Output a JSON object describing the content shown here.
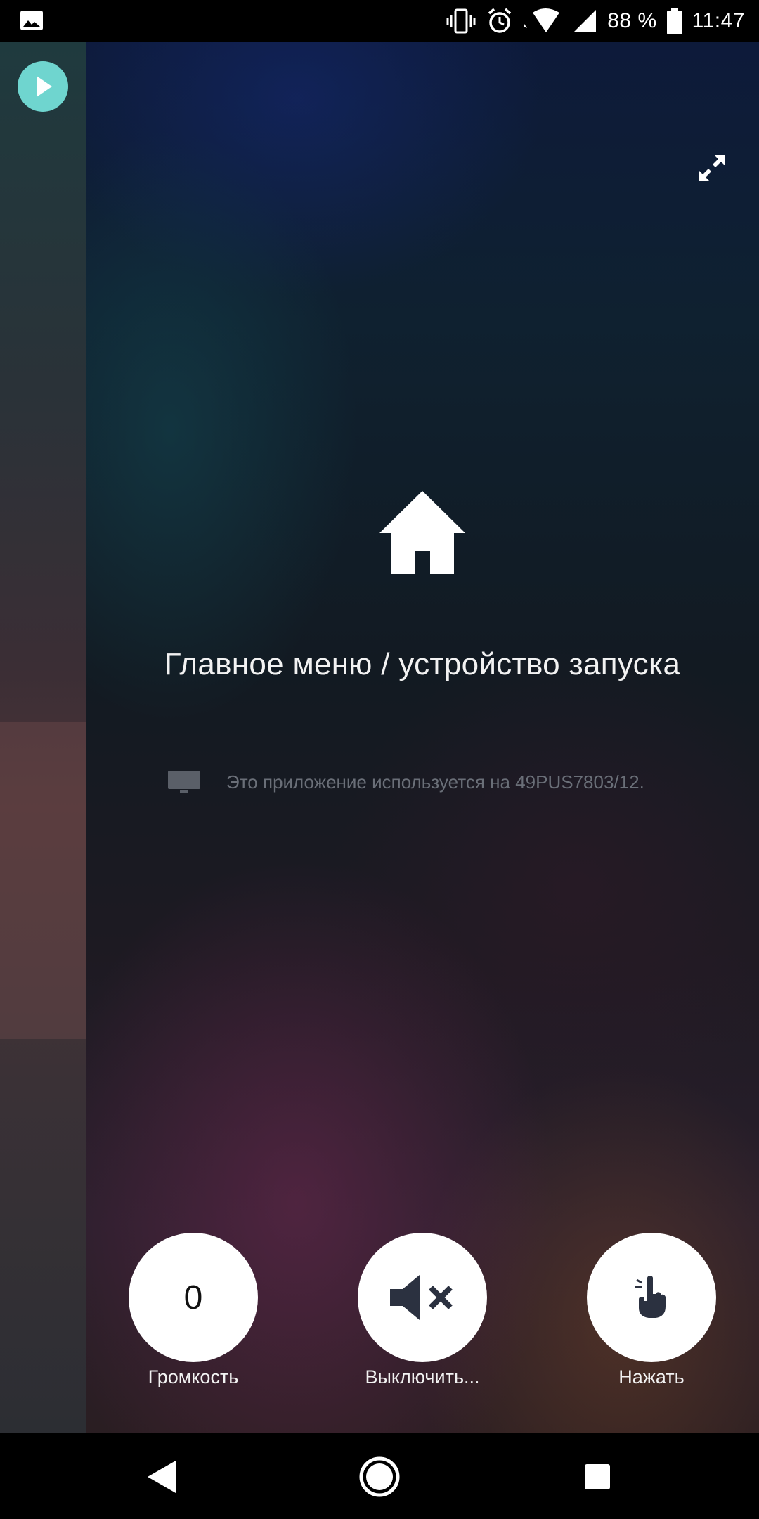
{
  "status_bar": {
    "battery_percent": "88 %",
    "time": "11:47",
    "icons": [
      "image-icon",
      "vibrate-icon",
      "alarm-icon",
      "wifi-icon",
      "signal-icon",
      "battery-icon"
    ]
  },
  "sidebar": {
    "play_icon": "play-icon",
    "accent_color": "#6fd5cf"
  },
  "main": {
    "expand_icon": "expand-icon",
    "home_icon": "home-icon",
    "title": "Главное меню / устройство запуска",
    "device_note": "Это приложение используется на 49PUS7803/12."
  },
  "actions": [
    {
      "value": "0",
      "label": "Громкость",
      "icon": "volume-value"
    },
    {
      "value": "",
      "label": "Выключить...",
      "icon": "mute-icon"
    },
    {
      "value": "",
      "label": "Нажать",
      "icon": "finger-press-icon"
    }
  ],
  "pager": {
    "pages": 2,
    "active_index": 0
  },
  "nav_bar": {
    "buttons": [
      "back-icon",
      "home-nav-icon",
      "recent-apps-icon"
    ]
  }
}
